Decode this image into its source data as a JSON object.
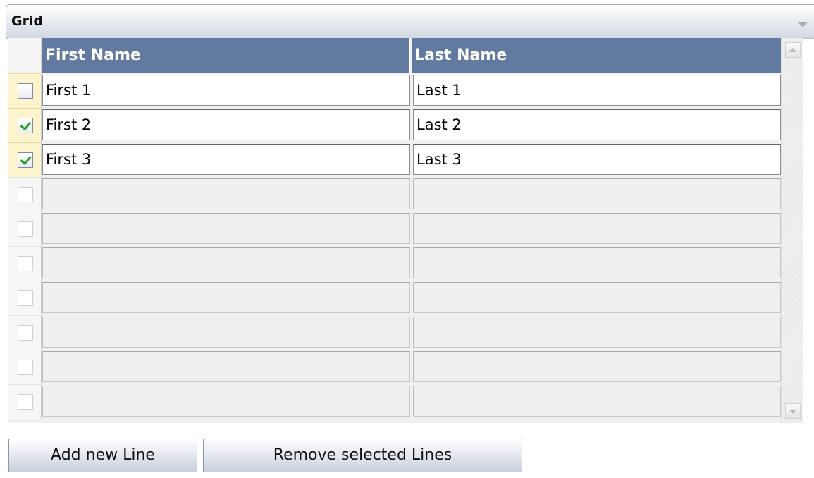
{
  "panel": {
    "title": "Grid",
    "collapse_icon": "triangle-down-icon"
  },
  "grid": {
    "columns": [
      "First Name",
      "Last Name"
    ],
    "rows": [
      {
        "checked": false,
        "first": "First 1",
        "last": "Last 1"
      },
      {
        "checked": true,
        "first": "First 2",
        "last": "Last 2"
      },
      {
        "checked": true,
        "first": "First 3",
        "last": "Last 3"
      }
    ],
    "empty_row_count": 7
  },
  "buttons": {
    "add_label": "Add new Line",
    "remove_label": "Remove selected Lines"
  },
  "colors": {
    "header_bg": "#637aa0",
    "selected_row_marker": "#fbf4cc",
    "checkmark": "#2f9e2f"
  }
}
